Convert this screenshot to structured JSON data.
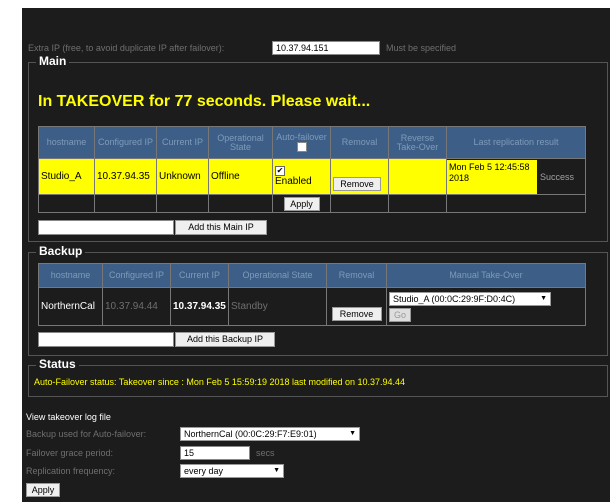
{
  "extra_ip": {
    "label": "Extra IP (free, to avoid duplicate IP after failover):",
    "value": "10.37.94.151",
    "hint": "Must be specified"
  },
  "main": {
    "legend": "Main",
    "takeover_msg": "In TAKEOVER for 77 seconds. Please wait...",
    "columns": [
      "hostname",
      "Configured IP",
      "Current IP",
      "Operational State",
      "Auto-failover",
      "Removal",
      "Reverse Take-Over",
      "Last replication result"
    ],
    "row": {
      "hostname": "Studio_A",
      "configured_ip": "10.37.94.35",
      "current_ip": "Unknown",
      "state": "Offline",
      "autofailover_label": "Enabled",
      "autofailover_checked": true,
      "remove_label": "Remove",
      "last_replication": "Mon Feb 5 12:45:58 2018",
      "result": "Success"
    },
    "apply_label": "Apply",
    "add_label": "Add this Main IP",
    "add_value": ""
  },
  "backup": {
    "legend": "Backup",
    "columns": [
      "hostname",
      "Configured IP",
      "Current IP",
      "Operational State",
      "Removal",
      "Manual Take-Over"
    ],
    "row": {
      "hostname": "NorthernCal",
      "configured_ip": "10.37.94.44",
      "current_ip": "10.37.94.35",
      "state": "Standby",
      "remove_label": "Remove",
      "takeover_select": "Studio_A (00:0C:29:9F:D0:4C)",
      "go_label": "Go"
    },
    "add_label": "Add this Backup IP",
    "add_value": ""
  },
  "status": {
    "legend": "Status",
    "text": "Auto-Failover status: Takeover since : Mon Feb 5 15:59:19 2018 last modified on 10.37.94.44"
  },
  "settings": {
    "log_link": "View takeover log file",
    "backup_label": "Backup used for Auto-failover:",
    "backup_value": "NorthernCal (00:0C:29:F7:E9:01)",
    "grace_label": "Failover grace period:",
    "grace_value": "15",
    "grace_unit": "secs",
    "freq_label": "Replication frequency:",
    "freq_value": "every day",
    "apply_label": "Apply"
  },
  "colors": {
    "background": "#1c1c1c",
    "header_blue": "#3d5f87",
    "highlight": "#ffff00",
    "status_text": "#ffff00"
  }
}
